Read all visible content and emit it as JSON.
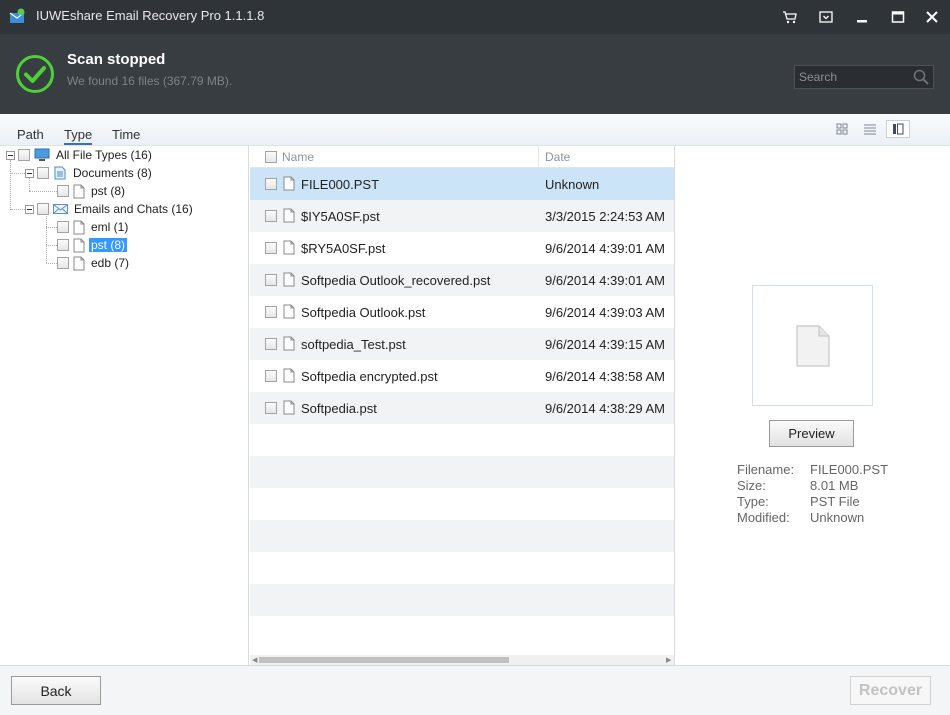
{
  "window": {
    "title": "IUWEshare Email Recovery Pro 1.1.1.8",
    "icons": [
      "app-icon",
      "cart-icon",
      "dropdown-menu-icon",
      "minimize-icon",
      "maximize-icon",
      "close-icon"
    ]
  },
  "status": {
    "title": "Scan stopped",
    "subtitle": "We found 16 files (367.79 MB).",
    "icon": "check-circle-icon",
    "accent_color": "#4cd137"
  },
  "search": {
    "placeholder": "Search",
    "icon": "search-icon"
  },
  "view_tabs": {
    "path": "Path",
    "type": "Type",
    "time": "Time",
    "active": "Type"
  },
  "view_modes": [
    "grid-view-icon",
    "list-view-icon",
    "detail-view-icon"
  ],
  "tree": {
    "all": "All File Types (16)",
    "documents": "Documents (8)",
    "documents_pst": "pst (8)",
    "emails": "Emails and Chats (16)",
    "eml": "eml (1)",
    "emails_pst": "pst (8)",
    "edb": "edb (7)",
    "selected": "pst (8)"
  },
  "list": {
    "col_name": "Name",
    "col_date": "Date",
    "rows": [
      {
        "name": "FILE000.PST",
        "date": "Unknown",
        "selected": true
      },
      {
        "name": "$IY5A0SF.pst",
        "date": "3/3/2015 2:24:53 AM"
      },
      {
        "name": "$RY5A0SF.pst",
        "date": "9/6/2014 4:39:01 AM"
      },
      {
        "name": "Softpedia Outlook_recovered.pst",
        "date": "9/6/2014 4:39:01 AM"
      },
      {
        "name": "Softpedia Outlook.pst",
        "date": "9/6/2014 4:39:03 AM"
      },
      {
        "name": "softpedia_Test.pst",
        "date": "9/6/2014 4:39:15 AM"
      },
      {
        "name": "Softpedia encrypted.pst",
        "date": "9/6/2014 4:38:58 AM"
      },
      {
        "name": "Softpedia.pst",
        "date": "9/6/2014 4:38:29 AM"
      }
    ]
  },
  "preview": {
    "button": "Preview",
    "filename_label": "Filename:",
    "filename": "FILE000.PST",
    "size_label": "Size:",
    "size": "8.01 MB",
    "type_label": "Type:",
    "type": "PST File",
    "modified_label": "Modified:",
    "modified": "Unknown"
  },
  "footer": {
    "back": "Back",
    "recover": "Recover"
  }
}
